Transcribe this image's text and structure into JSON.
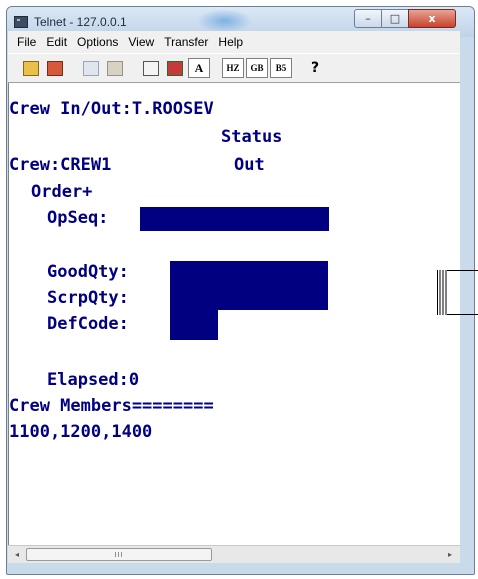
{
  "window": {
    "title": "Telnet - 127.0.0.1",
    "controls": {
      "minimize": "–",
      "maximize": "□",
      "close": "x"
    }
  },
  "menu": [
    "File",
    "Edit",
    "Options",
    "View",
    "Transfer",
    "Help"
  ],
  "toolbar": {
    "icons": [
      "connect-icon",
      "disconnect-icon",
      "copy-icon",
      "paste-icon",
      "properties-icon",
      "send-icon",
      "font-icon",
      "hz-encoding-icon",
      "gb-encoding-icon",
      "b5-encoding-icon",
      "help-icon"
    ],
    "font_label": "A",
    "hz_label": "HZ",
    "gb_label": "GB",
    "b5_label": "B5",
    "help_label": "?"
  },
  "terminal": {
    "title_line": "Crew In/Out:T.ROOSEV",
    "status_header": "Status",
    "crew_line": "Crew:CREW1",
    "crew_status": "Out",
    "order_label": "Order+",
    "opseq_label": "OpSeq:",
    "goodqty_label": "GoodQty:",
    "scrpqty_label": "ScrpQty:",
    "defcode_label": "DefCode:",
    "elapsed_line": "Elapsed:0",
    "members_line": "Crew Members========",
    "members_list": "1100,1200,1400",
    "text_color": "#000080",
    "field_color": "#000080"
  },
  "scrollbar": {
    "left_arrow": "◂",
    "right_arrow": "▸",
    "grip": "III"
  }
}
